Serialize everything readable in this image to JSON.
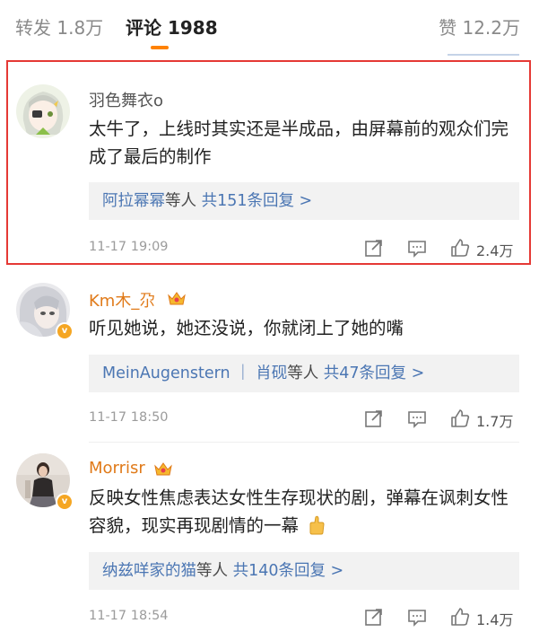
{
  "tabs": {
    "repost": "转发 1.8万",
    "comment": "评论 1988",
    "like": "赞 12.2万"
  },
  "colors": {
    "accent": "#ff8200",
    "link": "#4b76b3",
    "highlight_border": "#e53935",
    "vip_badge": "#f5a623"
  },
  "comments": [
    {
      "username": "羽色舞衣o",
      "username_color": "#555555",
      "content": "太牛了，上线时其实还是半成品，由屏幕前的观众们完成了最后的制作",
      "replies": {
        "names": "阿拉幂幂",
        "suffix": "等人",
        "total": "共151条回复 >"
      },
      "time": "11-17 19:09",
      "likes": "2.4万",
      "icons": [
        "repost-icon",
        "comment-icon",
        "like-icon"
      ]
    },
    {
      "username": "Km木_尕",
      "username_color": "#e07a19",
      "verified": "v",
      "content": "听见她说，她还没说，你就闭上了她的嘴",
      "replies": {
        "names": "MeinAugenstern ｜ 肖砚",
        "suffix": "等人",
        "total": "共47条回复 >"
      },
      "time": "11-17 18:50",
      "likes": "1.7万",
      "icons": [
        "repost-icon",
        "comment-icon",
        "like-icon"
      ]
    },
    {
      "username": "Morrisr",
      "username_color": "#e07a19",
      "verified": "v",
      "content": "反映女性焦虑表达女性生存现状的剧，弹幕在讽刺女性容貌，现实再现剧情的一幕",
      "replies": {
        "names": "纳兹咩家的猫",
        "suffix": "等人",
        "total": "共140条回复 >"
      },
      "time": "11-17 18:54",
      "likes": "1.4万",
      "icons": [
        "repost-icon",
        "comment-icon",
        "like-icon"
      ]
    }
  ]
}
